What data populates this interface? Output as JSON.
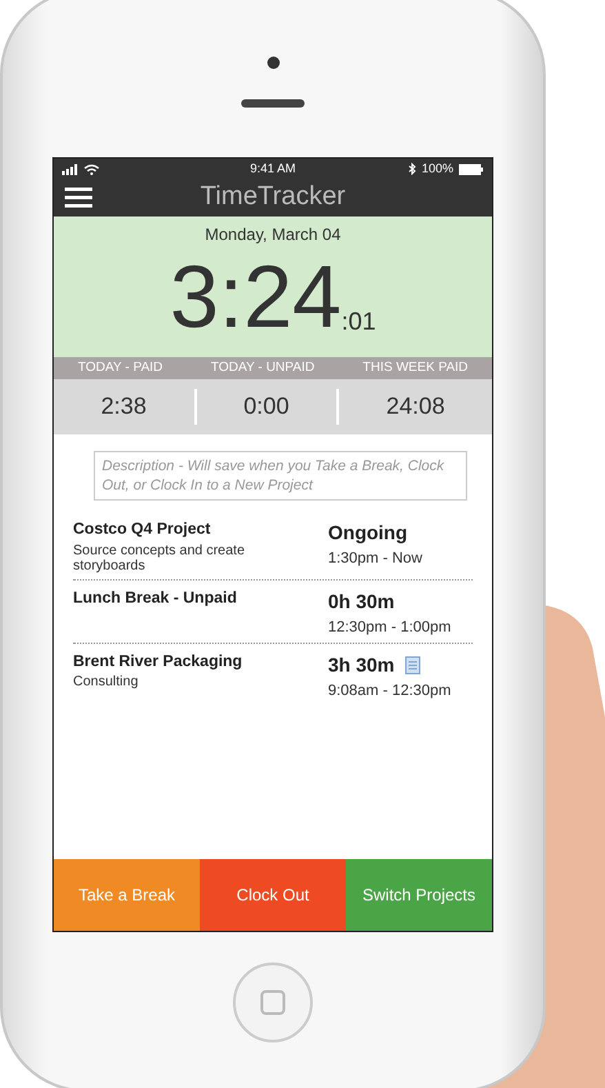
{
  "status_bar": {
    "time": "9:41 AM",
    "battery": "100%"
  },
  "app_bar": {
    "title": "TimeTracker"
  },
  "clock": {
    "date": "Monday, March 04",
    "hours_minutes": "3:24",
    "seconds": ":01"
  },
  "totals": [
    {
      "label": "TODAY - PAID",
      "value": "2:38"
    },
    {
      "label": "TODAY - UNPAID",
      "value": "0:00"
    },
    {
      "label": "THIS WEEK PAID",
      "value": "24:08"
    }
  ],
  "description": {
    "placeholder": "Description - Will save when you Take a Break, Clock Out, or Clock In to a New Project"
  },
  "entries": [
    {
      "name": "Costco Q4 Project",
      "detail": "Source concepts and create storyboards",
      "duration": "Ongoing",
      "range": "1:30pm - Now",
      "note": false
    },
    {
      "name": "Lunch Break - Unpaid",
      "duration": "0h 30m",
      "range": "12:30pm - 1:00pm",
      "note": false
    },
    {
      "name": "Brent River Packaging",
      "detail": "Consulting",
      "duration": "3h 30m",
      "range": "9:08am - 12:30pm",
      "note": true
    }
  ],
  "actions": [
    {
      "label": "Take a Break",
      "color": "#f08a24"
    },
    {
      "label": "Clock Out",
      "color": "#ef4b23"
    },
    {
      "label": "Switch Projects",
      "color": "#4aa546"
    }
  ]
}
